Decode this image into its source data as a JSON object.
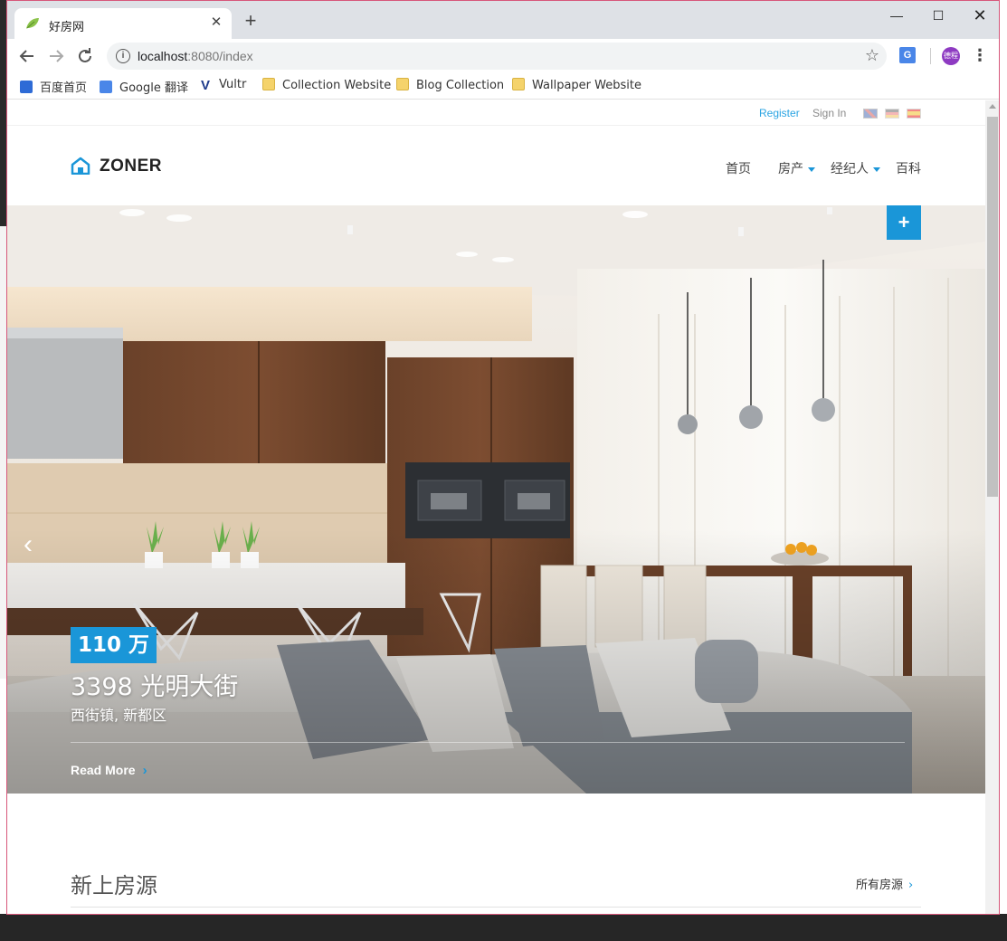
{
  "browser": {
    "tab_title": "好房网",
    "tab_close": "✕",
    "new_tab": "+",
    "window_controls": {
      "minimize": "—",
      "maximize": "☐",
      "close": "✕"
    },
    "url_host": "localhost",
    "url_path": ":8080/index",
    "avatar_text": "德程",
    "translate_icon_text": "G",
    "bookmarks": [
      {
        "label": "百度首页",
        "icon": "baidu-icon"
      },
      {
        "label": "Google 翻译",
        "icon": "google-translate-icon"
      },
      {
        "label": "Vultr",
        "icon": "vultr-icon",
        "glyph": "V"
      },
      {
        "label": "Collection Website",
        "icon": "folder-icon"
      },
      {
        "label": "Blog Collection",
        "icon": "folder-icon"
      },
      {
        "label": "Wallpaper Website",
        "icon": "folder-icon"
      }
    ]
  },
  "site": {
    "topbar": {
      "register": "Register",
      "sign_in": "Sign In"
    },
    "logo_text": "ZONER",
    "nav": {
      "home": "首页",
      "property": "房产",
      "agent": "经纪人",
      "wiki": "百科"
    },
    "accent_color": "#1a96d8",
    "hero": {
      "plus": "+",
      "prev": "‹",
      "price": "110 万",
      "address": "3398 光明大街",
      "district": "西街镇, 新都区",
      "read_more": "Read More",
      "chevron": "›"
    },
    "new_listings": {
      "title": "新上房源",
      "all_link": "所有房源",
      "chevron": "›"
    }
  }
}
